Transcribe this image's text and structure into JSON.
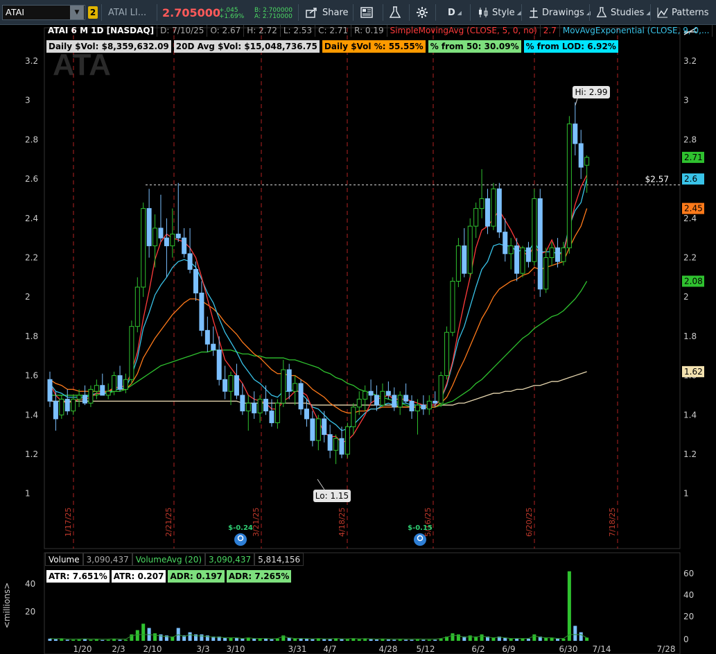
{
  "toolbar": {
    "symbol": "ATAI",
    "link_number": "2",
    "company_name": "ATAI LI...",
    "last_price": "2.705000",
    "change": "+.045",
    "change_pct": "+1.69%",
    "bid": "B: 2.700000",
    "ask": "A: 2.710000",
    "share_label": "Share",
    "timeframe": "D",
    "style_label": "Style",
    "drawings_label": "Drawings",
    "studies_label": "Studies",
    "patterns_label": "Patterns"
  },
  "chart_header": {
    "title": "ATAI 6 M 1D [NASDAQ]",
    "date": "D: 7/10/25",
    "open": "O: 2.67",
    "high": "H: 2.72",
    "low": "L: 2.53",
    "close": "C: 2.71",
    "range": "R: 0.19",
    "sma_study": "SimpleMovingAvg (CLOSE, 5, 0, no)",
    "sma_value": "2.7",
    "ema_study": "MovAvgExponential (CLOSE, 9, 0,..."
  },
  "info_boxes": [
    {
      "label": "Daily $Vol: $8,359,632.09",
      "color": "#d9d9d9"
    },
    {
      "label": "20D Avg $Vol: $15,048,736.75",
      "color": "#d9d9d9"
    },
    {
      "label": "Daily $Vol %: 55.55%",
      "color": "#ff9a00"
    },
    {
      "label": "% from 50: 30.09%",
      "color": "#7ee07e"
    },
    {
      "label": "% from LOD: 6.92%",
      "color": "#00e5ff"
    }
  ],
  "watermark": "ATA",
  "price_axis": {
    "ticks": [
      1,
      1.2,
      1.4,
      1.6,
      1.8,
      2,
      2.2,
      2.4,
      2.6,
      2.8,
      3,
      3.2
    ],
    "range": [
      0.85,
      3.3
    ],
    "tags": [
      {
        "value": 2.71,
        "label": "2.71",
        "color": "#2fc22f"
      },
      {
        "value": 2.6,
        "label": "2.6",
        "color": "#39c3e8"
      },
      {
        "value": 2.45,
        "label": "2.45",
        "color": "#ff7a1a"
      },
      {
        "value": 2.08,
        "label": "2.08",
        "color": "#2fc22f"
      },
      {
        "value": 1.62,
        "label": "1.62",
        "color": "#f3e2b0"
      }
    ]
  },
  "price_line": {
    "value": 2.57,
    "label": "$2.57"
  },
  "annotations": {
    "hi": {
      "label": "Hi: 2.99",
      "value": 2.99
    },
    "lo": {
      "label": "Lo: 1.15",
      "value": 1.15
    }
  },
  "period_labels": [
    "1/17/25",
    "2/21/25",
    "3/21/25",
    "4/18/25",
    "5/16/25",
    "6/20/25",
    "7/18/25"
  ],
  "earnings": [
    "$-0.24",
    "$-0.15"
  ],
  "x_axis_labels": [
    "1/20",
    "2/3",
    "2/10",
    "3/3",
    "3/10",
    "3/31",
    "4/7",
    "4/28",
    "5/12",
    "6/2",
    "6/9",
    "6/30",
    "7/14",
    "7/28"
  ],
  "volume_header": {
    "label": "Volume",
    "value": "3,090,437",
    "avg_label": "VolumeAvg (20)",
    "avg_value": "3,090,437",
    "avg_value2": "5,814,156"
  },
  "atr_boxes": [
    {
      "label": "ATR: 7.651%",
      "color": "#ffffff"
    },
    {
      "label": "ATR: 0.207",
      "color": "#ffffff"
    },
    {
      "label": "ADR: 0.197",
      "color": "#7ee07e"
    },
    {
      "label": "ADR: 7.265%",
      "color": "#7ee07e"
    }
  ],
  "volume_axis": {
    "ticks_left": [
      "40",
      "20"
    ],
    "ticks_right": [
      "60",
      "40",
      "20",
      "0"
    ],
    "unit_label": "<millions>"
  },
  "chart_data": {
    "type": "candlestick",
    "title": "ATAI 6 M 1D [NASDAQ]",
    "ylim": [
      0.85,
      3.3
    ],
    "candles": [
      [
        1.58,
        1.62,
        1.44,
        1.47
      ],
      [
        1.47,
        1.52,
        1.32,
        1.38
      ],
      [
        1.4,
        1.5,
        1.38,
        1.48
      ],
      [
        1.48,
        1.53,
        1.4,
        1.42
      ],
      [
        1.42,
        1.5,
        1.4,
        1.48
      ],
      [
        1.48,
        1.53,
        1.44,
        1.5
      ],
      [
        1.5,
        1.55,
        1.45,
        1.46
      ],
      [
        1.46,
        1.55,
        1.44,
        1.53
      ],
      [
        1.52,
        1.58,
        1.48,
        1.55
      ],
      [
        1.55,
        1.61,
        1.5,
        1.5
      ],
      [
        1.5,
        1.56,
        1.48,
        1.52
      ],
      [
        1.52,
        1.62,
        1.5,
        1.6
      ],
      [
        1.6,
        1.65,
        1.52,
        1.53
      ],
      [
        1.53,
        1.61,
        1.51,
        1.58
      ],
      [
        1.58,
        1.88,
        1.56,
        1.85
      ],
      [
        1.85,
        2.1,
        1.82,
        2.05
      ],
      [
        2.05,
        2.48,
        2.0,
        2.45
      ],
      [
        2.45,
        2.55,
        2.2,
        2.26
      ],
      [
        2.26,
        2.42,
        2.15,
        2.35
      ],
      [
        2.35,
        2.52,
        2.28,
        2.3
      ],
      [
        2.3,
        2.4,
        2.1,
        2.26
      ],
      [
        2.26,
        2.45,
        2.2,
        2.32
      ],
      [
        2.32,
        2.58,
        2.28,
        2.3
      ],
      [
        2.3,
        2.35,
        2.2,
        2.22
      ],
      [
        2.22,
        2.35,
        2.12,
        2.14
      ],
      [
        2.14,
        2.18,
        1.98,
        2.02
      ],
      [
        2.02,
        2.08,
        1.8,
        1.83
      ],
      [
        1.83,
        1.9,
        1.72,
        1.76
      ],
      [
        1.76,
        1.85,
        1.7,
        1.73
      ],
      [
        1.73,
        1.8,
        1.55,
        1.58
      ],
      [
        1.58,
        1.65,
        1.48,
        1.52
      ],
      [
        1.52,
        1.62,
        1.45,
        1.6
      ],
      [
        1.6,
        1.66,
        1.48,
        1.5
      ],
      [
        1.5,
        1.56,
        1.4,
        1.42
      ],
      [
        1.42,
        1.5,
        1.32,
        1.46
      ],
      [
        1.46,
        1.52,
        1.38,
        1.41
      ],
      [
        1.41,
        1.5,
        1.36,
        1.48
      ],
      [
        1.48,
        1.55,
        1.4,
        1.42
      ],
      [
        1.42,
        1.48,
        1.34,
        1.36
      ],
      [
        1.36,
        1.48,
        1.33,
        1.46
      ],
      [
        1.46,
        1.68,
        1.44,
        1.63
      ],
      [
        1.63,
        1.66,
        1.48,
        1.52
      ],
      [
        1.52,
        1.6,
        1.45,
        1.56
      ],
      [
        1.56,
        1.58,
        1.4,
        1.43
      ],
      [
        1.43,
        1.48,
        1.34,
        1.38
      ],
      [
        1.38,
        1.42,
        1.24,
        1.27
      ],
      [
        1.27,
        1.4,
        1.22,
        1.38
      ],
      [
        1.38,
        1.42,
        1.26,
        1.3
      ],
      [
        1.3,
        1.35,
        1.18,
        1.22
      ],
      [
        1.22,
        1.3,
        1.15,
        1.28
      ],
      [
        1.28,
        1.34,
        1.18,
        1.2
      ],
      [
        1.2,
        1.36,
        1.18,
        1.34
      ],
      [
        1.34,
        1.46,
        1.3,
        1.44
      ],
      [
        1.44,
        1.52,
        1.4,
        1.48
      ],
      [
        1.48,
        1.55,
        1.42,
        1.52
      ],
      [
        1.52,
        1.58,
        1.46,
        1.5
      ],
      [
        1.5,
        1.55,
        1.42,
        1.45
      ],
      [
        1.45,
        1.56,
        1.44,
        1.52
      ],
      [
        1.52,
        1.57,
        1.48,
        1.5
      ],
      [
        1.5,
        1.54,
        1.42,
        1.44
      ],
      [
        1.44,
        1.52,
        1.4,
        1.5
      ],
      [
        1.5,
        1.56,
        1.46,
        1.47
      ],
      [
        1.47,
        1.5,
        1.38,
        1.42
      ],
      [
        1.42,
        1.48,
        1.3,
        1.45
      ],
      [
        1.45,
        1.5,
        1.4,
        1.43
      ],
      [
        1.43,
        1.5,
        1.4,
        1.47
      ],
      [
        1.47,
        1.52,
        1.44,
        1.46
      ],
      [
        1.46,
        1.62,
        1.44,
        1.6
      ],
      [
        1.6,
        1.85,
        1.58,
        1.82
      ],
      [
        1.82,
        2.1,
        1.8,
        2.08
      ],
      [
        2.08,
        2.3,
        2.05,
        2.26
      ],
      [
        2.26,
        2.35,
        2.1,
        2.12
      ],
      [
        2.12,
        2.4,
        2.1,
        2.36
      ],
      [
        2.36,
        2.48,
        2.3,
        2.45
      ],
      [
        2.45,
        2.65,
        2.4,
        2.5
      ],
      [
        2.5,
        2.55,
        2.32,
        2.36
      ],
      [
        2.36,
        2.58,
        2.34,
        2.55
      ],
      [
        2.55,
        2.58,
        2.3,
        2.33
      ],
      [
        2.33,
        2.4,
        2.18,
        2.22
      ],
      [
        2.22,
        2.3,
        2.14,
        2.26
      ],
      [
        2.26,
        2.3,
        2.08,
        2.12
      ],
      [
        2.12,
        2.26,
        2.1,
        2.25
      ],
      [
        2.25,
        2.28,
        2.15,
        2.18
      ],
      [
        2.18,
        2.55,
        2.16,
        2.5
      ],
      [
        2.5,
        2.55,
        2.0,
        2.04
      ],
      [
        2.04,
        2.25,
        2.02,
        2.2
      ],
      [
        2.2,
        2.28,
        2.16,
        2.25
      ],
      [
        2.25,
        2.3,
        2.15,
        2.18
      ],
      [
        2.18,
        2.28,
        2.16,
        2.25
      ],
      [
        2.25,
        2.92,
        2.22,
        2.88
      ],
      [
        2.88,
        2.99,
        2.72,
        2.78
      ],
      [
        2.78,
        2.85,
        2.6,
        2.66
      ],
      [
        2.67,
        2.72,
        2.53,
        2.71
      ]
    ],
    "sma5": [
      1.56,
      1.5,
      1.47,
      1.46,
      1.47,
      1.48,
      1.48,
      1.49,
      1.51,
      1.51,
      1.52,
      1.54,
      1.54,
      1.55,
      1.62,
      1.72,
      1.89,
      2.03,
      2.19,
      2.28,
      2.32,
      2.3,
      2.29,
      2.28,
      2.25,
      2.2,
      2.1,
      1.99,
      1.88,
      1.78,
      1.68,
      1.64,
      1.6,
      1.56,
      1.5,
      1.48,
      1.47,
      1.46,
      1.43,
      1.43,
      1.47,
      1.49,
      1.52,
      1.52,
      1.5,
      1.43,
      1.37,
      1.31,
      1.29,
      1.29,
      1.26,
      1.27,
      1.3,
      1.35,
      1.4,
      1.46,
      1.48,
      1.49,
      1.5,
      1.48,
      1.48,
      1.48,
      1.47,
      1.46,
      1.45,
      1.45,
      1.45,
      1.48,
      1.56,
      1.67,
      1.83,
      1.97,
      2.1,
      2.25,
      2.34,
      2.36,
      2.4,
      2.44,
      2.39,
      2.34,
      2.28,
      2.23,
      2.21,
      2.26,
      2.22,
      2.23,
      2.29,
      2.22,
      2.22,
      2.35,
      2.47,
      2.56,
      2.62
    ],
    "ema9": [
      1.56,
      1.52,
      1.51,
      1.49,
      1.49,
      1.49,
      1.49,
      1.5,
      1.51,
      1.51,
      1.51,
      1.53,
      1.53,
      1.54,
      1.6,
      1.69,
      1.84,
      1.92,
      2.01,
      2.06,
      2.1,
      2.15,
      2.18,
      2.19,
      2.18,
      2.15,
      2.09,
      2.02,
      1.97,
      1.89,
      1.82,
      1.77,
      1.72,
      1.66,
      1.62,
      1.58,
      1.56,
      1.53,
      1.5,
      1.49,
      1.52,
      1.52,
      1.53,
      1.51,
      1.48,
      1.44,
      1.43,
      1.4,
      1.37,
      1.35,
      1.32,
      1.33,
      1.35,
      1.38,
      1.41,
      1.43,
      1.43,
      1.45,
      1.46,
      1.45,
      1.46,
      1.46,
      1.45,
      1.45,
      1.45,
      1.45,
      1.45,
      1.48,
      1.55,
      1.66,
      1.78,
      1.85,
      1.95,
      2.05,
      2.14,
      2.18,
      2.26,
      2.27,
      2.26,
      2.26,
      2.23,
      2.24,
      2.23,
      2.28,
      2.23,
      2.23,
      2.23,
      2.22,
      2.23,
      2.36,
      2.44,
      2.48,
      2.6
    ],
    "ema20": [
      1.58,
      1.56,
      1.55,
      1.53,
      1.53,
      1.52,
      1.52,
      1.52,
      1.52,
      1.52,
      1.52,
      1.53,
      1.53,
      1.53,
      1.56,
      1.61,
      1.69,
      1.74,
      1.79,
      1.83,
      1.87,
      1.91,
      1.94,
      1.97,
      1.99,
      1.99,
      1.98,
      1.96,
      1.94,
      1.91,
      1.87,
      1.84,
      1.81,
      1.77,
      1.74,
      1.71,
      1.69,
      1.66,
      1.63,
      1.61,
      1.61,
      1.6,
      1.6,
      1.58,
      1.56,
      1.53,
      1.51,
      1.49,
      1.46,
      1.44,
      1.42,
      1.41,
      1.41,
      1.42,
      1.42,
      1.43,
      1.43,
      1.44,
      1.44,
      1.44,
      1.44,
      1.44,
      1.44,
      1.44,
      1.44,
      1.44,
      1.44,
      1.46,
      1.49,
      1.55,
      1.62,
      1.68,
      1.75,
      1.82,
      1.89,
      1.94,
      2.0,
      2.04,
      2.06,
      2.08,
      2.09,
      2.11,
      2.12,
      2.15,
      2.14,
      2.15,
      2.16,
      2.17,
      2.18,
      2.25,
      2.31,
      2.36,
      2.45
    ],
    "sma50": [
      1.5,
      1.5,
      1.5,
      1.5,
      1.5,
      1.5,
      1.5,
      1.5,
      1.5,
      1.51,
      1.51,
      1.52,
      1.52,
      1.53,
      1.55,
      1.57,
      1.59,
      1.61,
      1.63,
      1.65,
      1.66,
      1.67,
      1.68,
      1.69,
      1.7,
      1.71,
      1.72,
      1.72,
      1.73,
      1.73,
      1.73,
      1.73,
      1.72,
      1.71,
      1.71,
      1.7,
      1.7,
      1.69,
      1.69,
      1.69,
      1.69,
      1.68,
      1.68,
      1.67,
      1.66,
      1.65,
      1.64,
      1.62,
      1.61,
      1.59,
      1.58,
      1.56,
      1.55,
      1.53,
      1.52,
      1.51,
      1.5,
      1.49,
      1.48,
      1.47,
      1.46,
      1.45,
      1.44,
      1.44,
      1.44,
      1.44,
      1.44,
      1.45,
      1.46,
      1.47,
      1.49,
      1.51,
      1.53,
      1.56,
      1.58,
      1.61,
      1.64,
      1.67,
      1.7,
      1.73,
      1.76,
      1.79,
      1.81,
      1.84,
      1.86,
      1.88,
      1.9,
      1.91,
      1.93,
      1.96,
      1.99,
      2.03,
      2.08
    ],
    "sma200": [
      1.47,
      1.47,
      1.47,
      1.47,
      1.47,
      1.47,
      1.47,
      1.47,
      1.47,
      1.47,
      1.47,
      1.47,
      1.47,
      1.47,
      1.47,
      1.47,
      1.47,
      1.47,
      1.47,
      1.47,
      1.47,
      1.47,
      1.47,
      1.47,
      1.47,
      1.47,
      1.47,
      1.47,
      1.47,
      1.47,
      1.47,
      1.47,
      1.47,
      1.46,
      1.46,
      1.46,
      1.46,
      1.46,
      1.46,
      1.46,
      1.46,
      1.46,
      1.46,
      1.46,
      1.46,
      1.45,
      1.45,
      1.45,
      1.45,
      1.45,
      1.45,
      1.45,
      1.45,
      1.45,
      1.45,
      1.45,
      1.45,
      1.45,
      1.45,
      1.45,
      1.44,
      1.44,
      1.44,
      1.44,
      1.44,
      1.44,
      1.44,
      1.45,
      1.45,
      1.45,
      1.46,
      1.46,
      1.47,
      1.48,
      1.49,
      1.5,
      1.51,
      1.51,
      1.52,
      1.52,
      1.53,
      1.53,
      1.54,
      1.55,
      1.55,
      1.56,
      1.57,
      1.57,
      1.58,
      1.59,
      1.6,
      1.61,
      1.62
    ],
    "volume_millions": [
      2,
      1.5,
      1.8,
      1,
      1,
      1.2,
      1.5,
      1,
      1.2,
      0.8,
      1,
      1.5,
      1,
      1,
      6,
      10,
      16,
      12,
      7,
      6,
      5,
      4,
      12,
      5,
      8,
      6,
      6,
      5,
      4,
      4,
      3,
      3,
      3,
      2,
      3,
      2,
      2,
      2,
      1.5,
      2,
      5,
      3,
      2,
      2,
      1.8,
      1.5,
      2,
      1.5,
      1.5,
      2,
      1.5,
      1.5,
      2,
      1.5,
      1.8,
      1.5,
      1.2,
      1.5,
      1.2,
      1,
      1.2,
      1,
      1,
      1.2,
      1,
      1,
      1,
      2,
      4,
      7,
      6,
      4,
      5,
      4,
      6,
      4,
      3,
      4,
      3,
      2,
      2,
      2,
      2,
      6,
      4,
      3,
      3,
      2,
      2,
      65,
      14,
      8,
      3
    ]
  }
}
